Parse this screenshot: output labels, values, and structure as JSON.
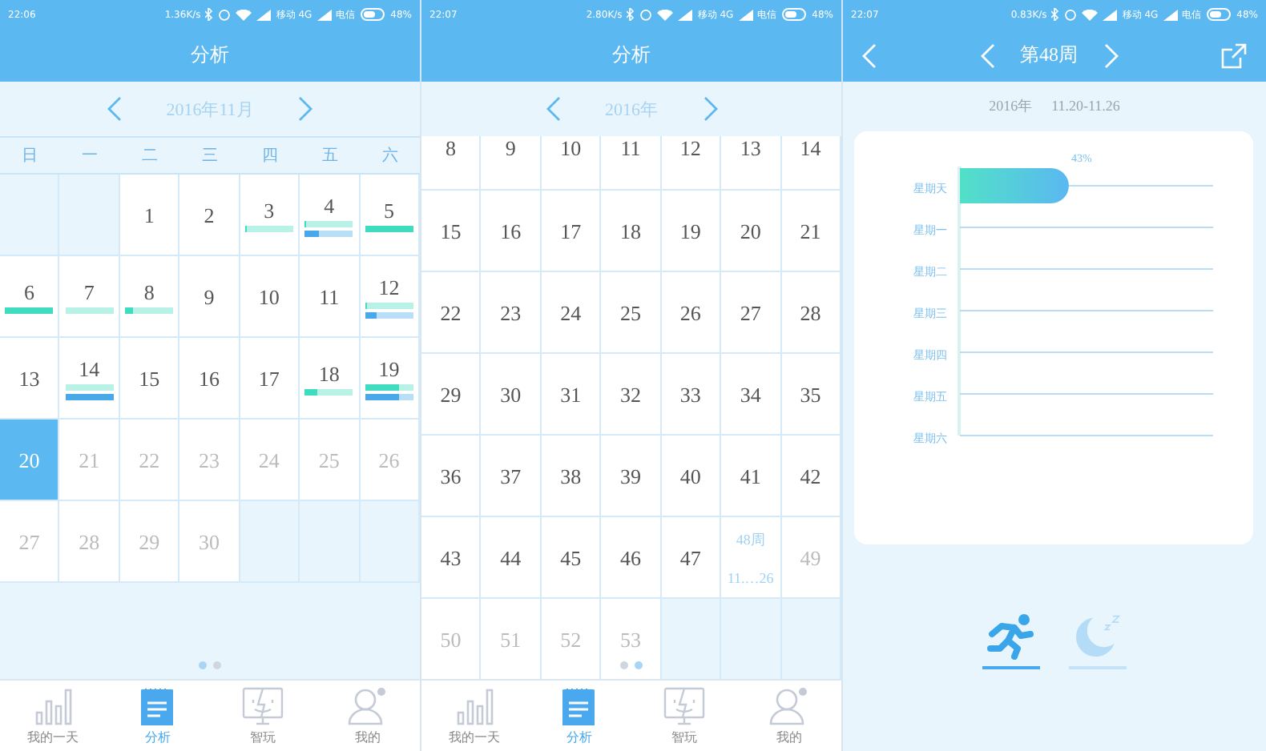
{
  "month_screen": {
    "status_bar": {
      "time": "22:06",
      "speed": "1.36K/s",
      "carrier_1": "移动 4G",
      "carrier_2": "电信",
      "battery": "48%"
    },
    "title": "分析",
    "nav": {
      "label": "2016年11月"
    },
    "weekdays": [
      "日",
      "一",
      "二",
      "三",
      "四",
      "五",
      "六"
    ],
    "days": [
      {
        "kind": "blank"
      },
      {
        "kind": "blank"
      },
      {
        "kind": "past",
        "day": "1"
      },
      {
        "kind": "past",
        "day": "2"
      },
      {
        "kind": "past",
        "day": "3",
        "bars": [
          {
            "kind": "activity",
            "level": 0.05
          }
        ]
      },
      {
        "kind": "past",
        "day": "4",
        "bars": [
          {
            "kind": "activity",
            "level": 0.03
          },
          {
            "kind": "sleep",
            "level": 0.28
          }
        ]
      },
      {
        "kind": "past",
        "day": "5",
        "bars": [
          {
            "kind": "activity",
            "level": 1
          }
        ]
      },
      {
        "kind": "past",
        "day": "6",
        "bars": [
          {
            "kind": "activity",
            "level": 1
          }
        ]
      },
      {
        "kind": "past",
        "day": "7",
        "bars": [
          {
            "kind": "activity",
            "level": 0
          }
        ]
      },
      {
        "kind": "past",
        "day": "8",
        "bars": [
          {
            "kind": "activity",
            "level": 0.17
          }
        ]
      },
      {
        "kind": "past",
        "day": "9"
      },
      {
        "kind": "past",
        "day": "10"
      },
      {
        "kind": "past",
        "day": "11"
      },
      {
        "kind": "past",
        "day": "12",
        "bars": [
          {
            "kind": "activity",
            "level": 0.03
          },
          {
            "kind": "sleep",
            "level": 0.25
          }
        ]
      },
      {
        "kind": "past",
        "day": "13"
      },
      {
        "kind": "past",
        "day": "14",
        "bars": [
          {
            "kind": "activity",
            "level": 0
          },
          {
            "kind": "sleep",
            "level": 1
          }
        ]
      },
      {
        "kind": "past",
        "day": "15"
      },
      {
        "kind": "past",
        "day": "16"
      },
      {
        "kind": "past",
        "day": "17"
      },
      {
        "kind": "past",
        "day": "18",
        "bars": [
          {
            "kind": "activity",
            "level": 0.25
          }
        ]
      },
      {
        "kind": "past",
        "day": "19",
        "bars": [
          {
            "kind": "activity",
            "level": 0.72
          },
          {
            "kind": "sleep",
            "level": 0.7
          }
        ]
      },
      {
        "kind": "today",
        "day": "20"
      },
      {
        "kind": "future",
        "day": "21"
      },
      {
        "kind": "future",
        "day": "22"
      },
      {
        "kind": "future",
        "day": "23"
      },
      {
        "kind": "future",
        "day": "24"
      },
      {
        "kind": "future",
        "day": "25"
      },
      {
        "kind": "future",
        "day": "26"
      },
      {
        "kind": "future",
        "day": "27"
      },
      {
        "kind": "future",
        "day": "28"
      },
      {
        "kind": "future",
        "day": "29"
      },
      {
        "kind": "future",
        "day": "30"
      },
      {
        "kind": "blank"
      },
      {
        "kind": "blank"
      },
      {
        "kind": "blank"
      }
    ],
    "pager": [
      {
        "selected": true
      },
      {
        "selected": false
      }
    ],
    "tabs": [
      {
        "kind": "day",
        "label": "我的一天",
        "selected": false
      },
      {
        "kind": "analysis",
        "label": "分析",
        "selected": true
      },
      {
        "kind": "play",
        "label": "智玩",
        "selected": false
      },
      {
        "kind": "profile",
        "label": "我的",
        "selected": false
      }
    ]
  },
  "year_screen": {
    "status_bar": {
      "time": "22:07",
      "speed": "2.80K/s",
      "carrier_1": "移动 4G",
      "carrier_2": "电信",
      "battery": "48%"
    },
    "title": "分析",
    "nav": {
      "label": "2016年"
    },
    "partial_row": [
      "8",
      "9",
      "10",
      "11",
      "12",
      "13",
      "14"
    ],
    "weeks": [
      {
        "kind": "past",
        "week": "15"
      },
      {
        "kind": "past",
        "week": "16"
      },
      {
        "kind": "past",
        "week": "17"
      },
      {
        "kind": "past",
        "week": "18"
      },
      {
        "kind": "past",
        "week": "19"
      },
      {
        "kind": "past",
        "week": "20"
      },
      {
        "kind": "past",
        "week": "21"
      },
      {
        "kind": "past",
        "week": "22"
      },
      {
        "kind": "past",
        "week": "23"
      },
      {
        "kind": "past",
        "week": "24"
      },
      {
        "kind": "past",
        "week": "25"
      },
      {
        "kind": "past",
        "week": "26"
      },
      {
        "kind": "past",
        "week": "27"
      },
      {
        "kind": "past",
        "week": "28"
      },
      {
        "kind": "past",
        "week": "29"
      },
      {
        "kind": "past",
        "week": "30"
      },
      {
        "kind": "past",
        "week": "31"
      },
      {
        "kind": "past",
        "week": "32"
      },
      {
        "kind": "past",
        "week": "33"
      },
      {
        "kind": "past",
        "week": "34"
      },
      {
        "kind": "past",
        "week": "35"
      },
      {
        "kind": "past",
        "week": "36"
      },
      {
        "kind": "past",
        "week": "37"
      },
      {
        "kind": "past",
        "week": "38"
      },
      {
        "kind": "past",
        "week": "39"
      },
      {
        "kind": "past",
        "week": "40"
      },
      {
        "kind": "past",
        "week": "41"
      },
      {
        "kind": "past",
        "week": "42"
      },
      {
        "kind": "past",
        "week": "43"
      },
      {
        "kind": "past",
        "week": "44"
      },
      {
        "kind": "past",
        "week": "45"
      },
      {
        "kind": "past",
        "week": "46"
      },
      {
        "kind": "past",
        "week": "47"
      },
      {
        "kind": "current",
        "week": "48周",
        "range": "11.…26"
      },
      {
        "kind": "future",
        "week": "49"
      },
      {
        "kind": "future",
        "week": "50"
      },
      {
        "kind": "future",
        "week": "51"
      },
      {
        "kind": "future",
        "week": "52"
      },
      {
        "kind": "future",
        "week": "53"
      },
      {
        "kind": "blank"
      },
      {
        "kind": "blank"
      },
      {
        "kind": "blank"
      }
    ],
    "pager": [
      {
        "selected": false
      },
      {
        "selected": true
      }
    ],
    "tabs": [
      {
        "kind": "day",
        "label": "我的一天",
        "selected": false
      },
      {
        "kind": "analysis",
        "label": "分析",
        "selected": true
      },
      {
        "kind": "play",
        "label": "智玩",
        "selected": false
      },
      {
        "kind": "profile",
        "label": "我的",
        "selected": false
      }
    ]
  },
  "week_screen": {
    "status_bar": {
      "time": "22:07",
      "speed": "0.83K/s",
      "carrier_1": "移动 4G",
      "carrier_2": "电信",
      "battery": "48%"
    },
    "title": "第48周",
    "subtitle_year": "2016年",
    "subtitle_range": "11.20-11.26",
    "chart_data": {
      "type": "bar",
      "orientation": "horizontal",
      "categories": [
        "星期天",
        "星期一",
        "星期二",
        "星期三",
        "星期四",
        "星期五",
        "星期六"
      ],
      "values": [
        43,
        0,
        0,
        0,
        0,
        0,
        0
      ],
      "xlim": [
        0,
        100
      ],
      "value_labels": [
        "43%",
        null,
        null,
        null,
        null,
        null,
        null
      ]
    },
    "modes": [
      {
        "kind": "run",
        "selected": true
      },
      {
        "kind": "sleep",
        "selected": false
      }
    ]
  }
}
